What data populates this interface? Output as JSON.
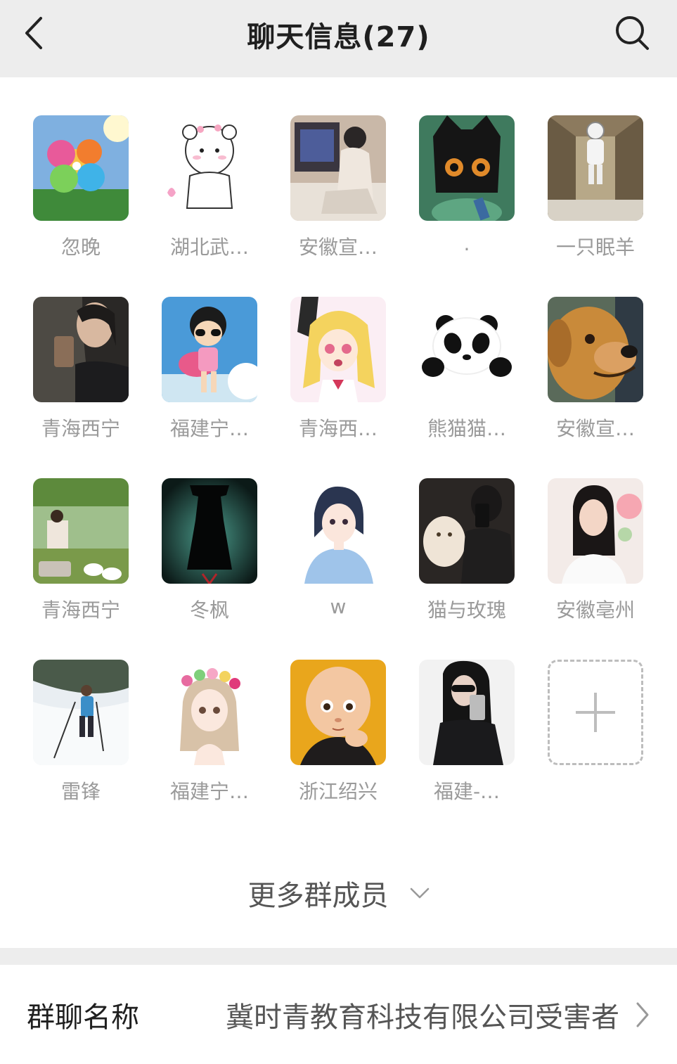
{
  "header": {
    "title": "聊天信息(27)"
  },
  "members": [
    {
      "name": "忽晚",
      "icon": "pinwheel-avatar"
    },
    {
      "name": "湖北武…",
      "icon": "cartoon-bear-avatar"
    },
    {
      "name": "安徽宣…",
      "icon": "girl-computer-avatar"
    },
    {
      "name": ".",
      "icon": "black-cat-avatar"
    },
    {
      "name": "一只眠羊",
      "icon": "astronaut-avatar"
    },
    {
      "name": "青海西宁",
      "icon": "girl-drinking-avatar"
    },
    {
      "name": "福建宁…",
      "icon": "cartoon-girl-sunglasses-avatar"
    },
    {
      "name": "青海西…",
      "icon": "anime-blonde-girl-avatar"
    },
    {
      "name": "熊猫猫…",
      "icon": "panda-avatar"
    },
    {
      "name": "安徽宣…",
      "icon": "dog-avatar"
    },
    {
      "name": "青海西宁",
      "icon": "lake-geese-avatar"
    },
    {
      "name": "冬枫",
      "icon": "silhouette-avatar"
    },
    {
      "name": "w",
      "icon": "anime-short-hair-avatar"
    },
    {
      "name": "猫与玫瑰",
      "icon": "man-cat-avatar"
    },
    {
      "name": "安徽亳州",
      "icon": "woman-portrait-avatar"
    },
    {
      "name": "雷锋",
      "icon": "snow-hiker-avatar"
    },
    {
      "name": "福建宁…",
      "icon": "flower-crown-girl-avatar"
    },
    {
      "name": "浙江绍兴",
      "icon": "bald-boy-avatar"
    },
    {
      "name": "福建-…",
      "icon": "mirror-selfie-avatar"
    }
  ],
  "add_member": {
    "icon": "plus-icon"
  },
  "more_members": {
    "label": "更多群成员",
    "icon": "chevron-down-icon"
  },
  "group_name": {
    "label": "群聊名称",
    "value": "冀时青教育科技有限公司受害者",
    "icon": "chevron-right-icon"
  }
}
